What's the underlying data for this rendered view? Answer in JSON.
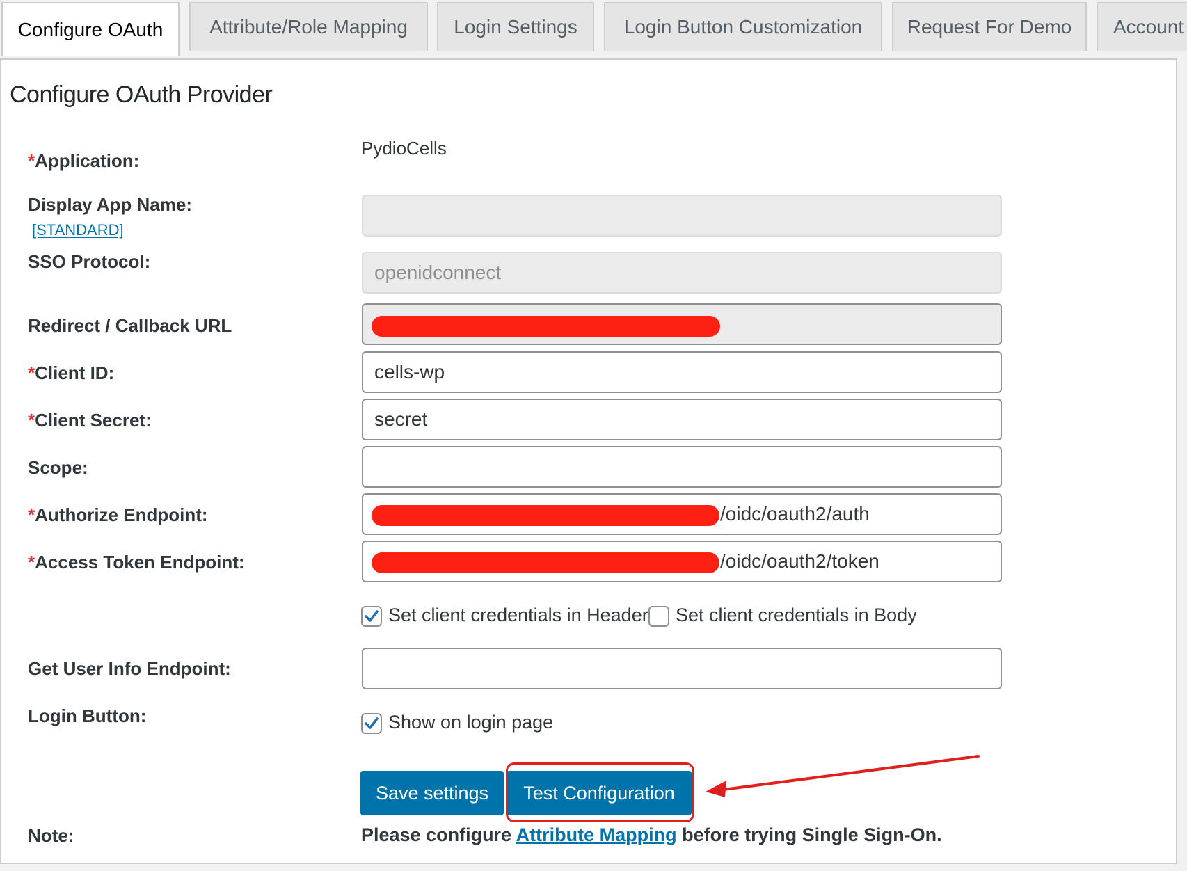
{
  "tabs": [
    {
      "label": "Configure OAuth",
      "active": true
    },
    {
      "label": "Attribute/Role Mapping",
      "active": false
    },
    {
      "label": "Login Settings",
      "active": false
    },
    {
      "label": "Login Button Customization",
      "active": false
    },
    {
      "label": "Request For Demo",
      "active": false
    },
    {
      "label": "Account",
      "active": false
    }
  ],
  "page_title": "Configure OAuth Provider",
  "required_marker": "*",
  "form": {
    "application": {
      "label": "Application:",
      "value": "PydioCells"
    },
    "display_app_name": {
      "label": "Display App Name:",
      "link": "[STANDARD]",
      "value": ""
    },
    "sso_protocol": {
      "label": "SSO Protocol:",
      "value": "openidconnect"
    },
    "redirect_url": {
      "label": "Redirect / Callback URL",
      "value_redacted": true
    },
    "client_id": {
      "label": "Client ID:",
      "value": "cells-wp"
    },
    "client_secret": {
      "label": "Client Secret:",
      "value": "secret"
    },
    "scope": {
      "label": "Scope:",
      "value": ""
    },
    "authorize_endpoint": {
      "label": "Authorize Endpoint:",
      "visible_suffix": "/oidc/oauth2/auth"
    },
    "access_token_endpoint": {
      "label": "Access Token Endpoint:",
      "visible_suffix": "/oidc/oauth2/token"
    },
    "credentials_header": {
      "label": "Set client credentials in Header",
      "checked": true
    },
    "credentials_body": {
      "label": "Set client credentials in Body",
      "checked": false
    },
    "user_info_endpoint": {
      "label": "Get User Info Endpoint:",
      "value": ""
    },
    "login_button": {
      "label": "Login Button:",
      "option_label": "Show on login page",
      "checked": true
    }
  },
  "buttons": {
    "save": "Save settings",
    "test": "Test Configuration"
  },
  "note": {
    "label": "Note:",
    "prefix": "Please configure",
    "link": "Attribute Mapping",
    "suffix": "before trying Single Sign-On."
  },
  "colors": {
    "accent": "#0073aa",
    "redaction": "#fe2012",
    "annotation": "#e0201c"
  },
  "icons": {
    "checkmark": "checkmark-icon",
    "arrow": "arrow-left-icon"
  }
}
